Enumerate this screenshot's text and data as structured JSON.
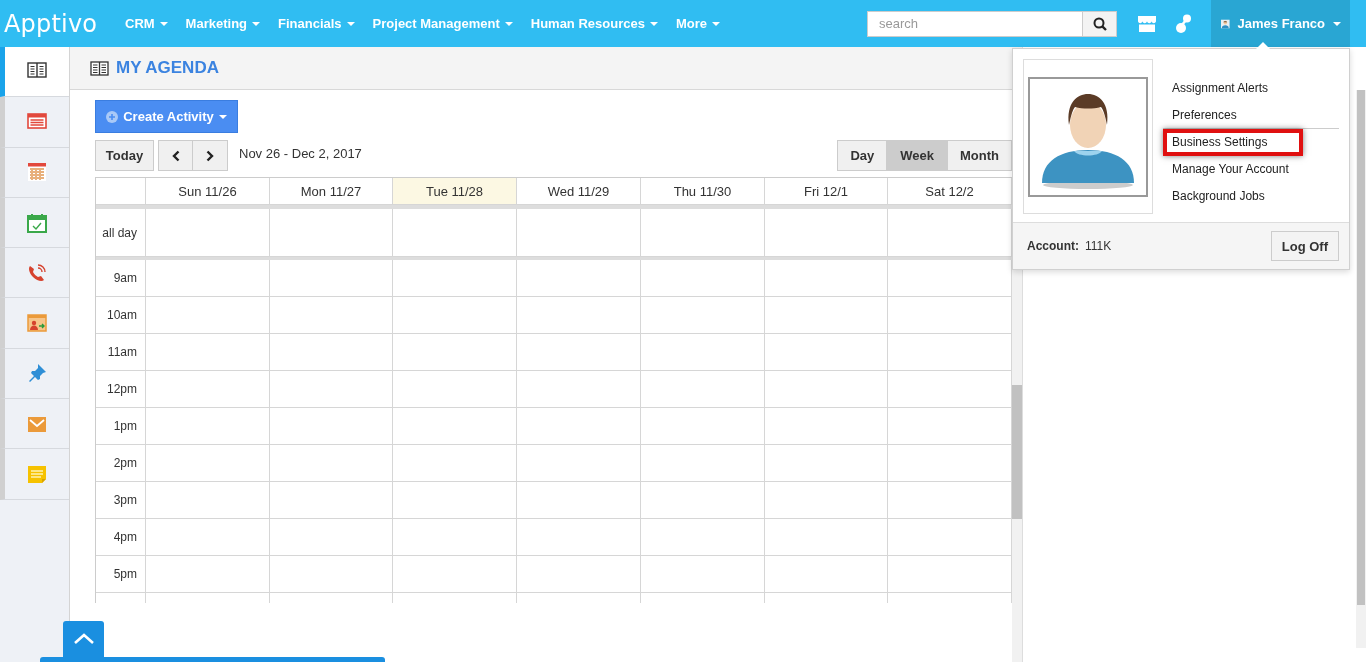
{
  "top_bar": {
    "logo": "Apptivo",
    "menu": [
      {
        "label": "CRM"
      },
      {
        "label": "Marketing"
      },
      {
        "label": "Financials"
      },
      {
        "label": "Project Management"
      },
      {
        "label": "Human Resources"
      },
      {
        "label": "More"
      }
    ],
    "search": {
      "placeholder": "search"
    },
    "user": {
      "name": "James Franco"
    }
  },
  "sidebar": {
    "items": [
      {
        "kind": "agenda",
        "selected": true
      },
      {
        "kind": "list",
        "selected": false
      },
      {
        "kind": "calendar",
        "selected": false
      },
      {
        "kind": "tasks",
        "selected": false
      },
      {
        "kind": "calls",
        "selected": false
      },
      {
        "kind": "events",
        "selected": false
      },
      {
        "kind": "pin",
        "selected": false
      },
      {
        "kind": "email",
        "selected": false
      },
      {
        "kind": "notes",
        "selected": false
      }
    ]
  },
  "page": {
    "title": "MY AGENDA"
  },
  "toolbar": {
    "create_button": "Create Activity",
    "today_button": "Today",
    "date_range": "Nov 26 - Dec 2, 2017",
    "views": [
      {
        "label": "Day",
        "selected": false
      },
      {
        "label": "Week",
        "selected": true
      },
      {
        "label": "Month",
        "selected": false
      }
    ]
  },
  "calendar": {
    "days": [
      {
        "label": "Sun 11/26",
        "today": false
      },
      {
        "label": "Mon 11/27",
        "today": false
      },
      {
        "label": "Tue 11/28",
        "today": true
      },
      {
        "label": "Wed 11/29",
        "today": false
      },
      {
        "label": "Thu 11/30",
        "today": false
      },
      {
        "label": "Fri 12/1",
        "today": false
      },
      {
        "label": "Sat 12/2",
        "today": false
      }
    ],
    "all_day_label": "all day",
    "hours": [
      "9am",
      "10am",
      "11am",
      "12pm",
      "1pm",
      "2pm",
      "3pm",
      "4pm",
      "5pm"
    ]
  },
  "user_menu": {
    "items": [
      {
        "label": "Assignment Alerts",
        "highlighted": false
      },
      {
        "label": "Preferences",
        "highlighted": false
      },
      {
        "label": "Business Settings",
        "highlighted": true
      },
      {
        "label": "Manage Your Account",
        "highlighted": false
      },
      {
        "label": "Background Jobs",
        "highlighted": false
      }
    ],
    "account_label": "Account:",
    "account_value": "111K",
    "logoff_button": "Log Off"
  }
}
